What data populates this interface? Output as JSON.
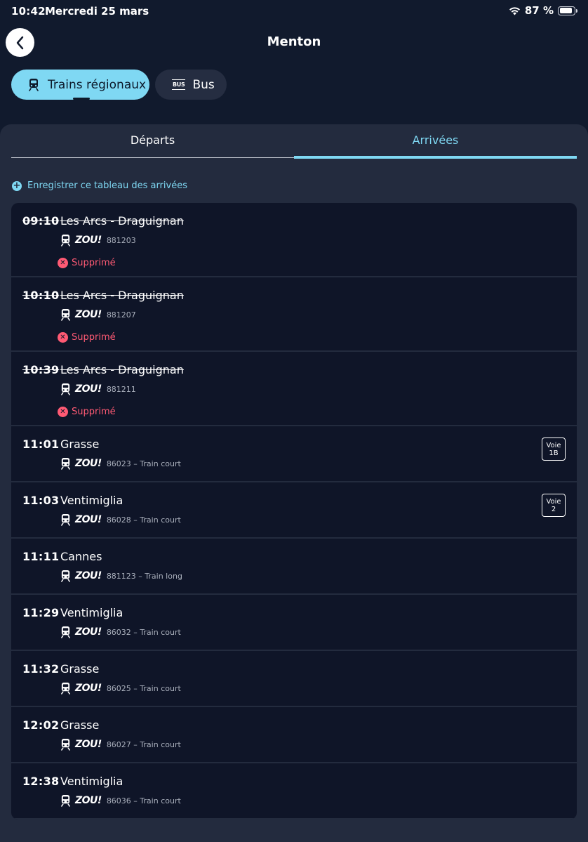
{
  "status_bar": {
    "time": "10:42",
    "date": "Mercredi 25 mars",
    "battery": "87 %",
    "battery_level": 0.87
  },
  "header": {
    "title": "Menton"
  },
  "modes": {
    "trains_label": "Trains régionaux",
    "bus_label": "Bus",
    "bus_icon_text": "BUS"
  },
  "tabs": {
    "departs": "Départs",
    "arrivees": "Arrivées",
    "active": "arrivees"
  },
  "save_label": "Enregistrer ce tableau des arrivées",
  "arrivals": [
    {
      "time": "09:10",
      "destination": "Les Arcs - Draguignan",
      "brand": "ZOU!",
      "detail": "881203",
      "status": "Supprimé",
      "cancelled": true
    },
    {
      "time": "10:10",
      "destination": "Les Arcs - Draguignan",
      "brand": "ZOU!",
      "detail": "881207",
      "status": "Supprimé",
      "cancelled": true
    },
    {
      "time": "10:39",
      "destination": "Les Arcs - Draguignan",
      "brand": "ZOU!",
      "detail": "881211",
      "status": "Supprimé",
      "cancelled": true
    },
    {
      "time": "11:01",
      "destination": "Grasse",
      "brand": "ZOU!",
      "detail": "86023 – Train court",
      "voie_label": "Voie",
      "voie": "1B"
    },
    {
      "time": "11:03",
      "destination": "Ventimiglia",
      "brand": "ZOU!",
      "detail": "86028 – Train court",
      "voie_label": "Voie",
      "voie": "2"
    },
    {
      "time": "11:11",
      "destination": "Cannes",
      "brand": "ZOU!",
      "detail": "881123 – Train long"
    },
    {
      "time": "11:29",
      "destination": "Ventimiglia",
      "brand": "ZOU!",
      "detail": "86032 – Train court"
    },
    {
      "time": "11:32",
      "destination": "Grasse",
      "brand": "ZOU!",
      "detail": "86025 – Train court"
    },
    {
      "time": "12:02",
      "destination": "Grasse",
      "brand": "ZOU!",
      "detail": "86027 – Train court"
    },
    {
      "time": "12:38",
      "destination": "Ventimiglia",
      "brand": "ZOU!",
      "detail": "86036 – Train court"
    }
  ],
  "colors": {
    "accent": "#7fd8f3",
    "background": "#111a2d",
    "panel": "#232b3e",
    "card": "#0f1528",
    "cancelled": "#ff5a74"
  },
  "icons": {
    "back": "chevron-left-icon",
    "train": "train-icon",
    "bus": "bus-icon",
    "wifi": "wifi-icon",
    "battery": "battery-icon",
    "plus": "plus-circle-icon",
    "cancelled": "cancelled-icon"
  }
}
